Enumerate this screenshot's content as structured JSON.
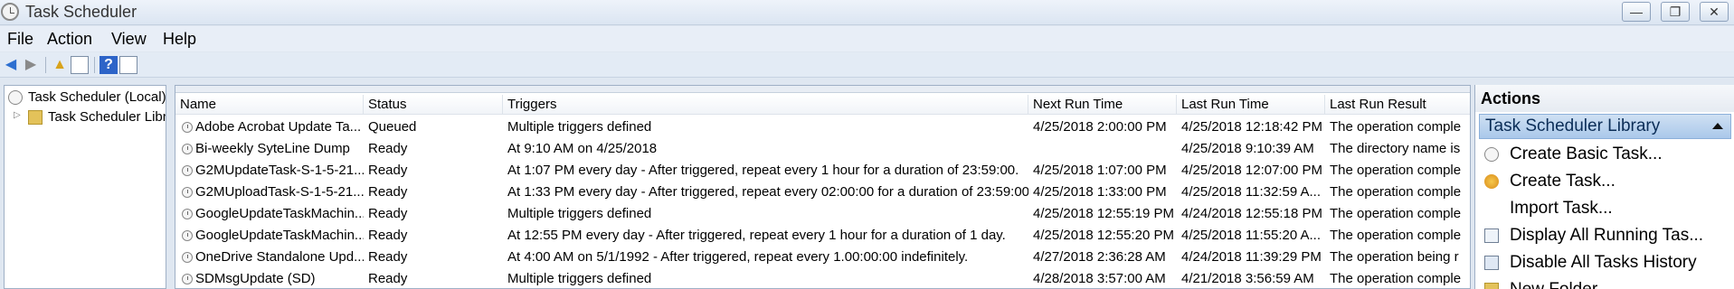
{
  "window": {
    "title": "Task Scheduler",
    "controls": {
      "minimize": "—",
      "restore": "❐",
      "close": "✕"
    }
  },
  "menu": [
    "File",
    "Action",
    "View",
    "Help"
  ],
  "tree": {
    "root": "Task Scheduler (Local)",
    "child": "Task Scheduler Library"
  },
  "list": {
    "headers": {
      "name": "Name",
      "status": "Status",
      "triggers": "Triggers",
      "next_run": "Next Run Time",
      "last_run": "Last Run Time",
      "last_result": "Last Run Result"
    },
    "rows": [
      {
        "name": "Adobe Acrobat Update Ta...",
        "status": "Queued",
        "triggers": "Multiple triggers defined",
        "next_run": "4/25/2018 2:00:00 PM",
        "last_run": "4/25/2018 12:18:42 PM",
        "last_result": "The operation comple"
      },
      {
        "name": "Bi-weekly SyteLine Dump",
        "status": "Ready",
        "triggers": "At 9:10 AM on 4/25/2018",
        "next_run": "",
        "last_run": "4/25/2018 9:10:39 AM",
        "last_result": "The directory name is"
      },
      {
        "name": "G2MUpdateTask-S-1-5-21...",
        "status": "Ready",
        "triggers": "At 1:07 PM every day - After triggered, repeat every 1 hour for a duration of 23:59:00.",
        "next_run": "4/25/2018 1:07:00 PM",
        "last_run": "4/25/2018 12:07:00 PM",
        "last_result": "The operation comple"
      },
      {
        "name": "G2MUploadTask-S-1-5-21...",
        "status": "Ready",
        "triggers": "At 1:33 PM every day - After triggered, repeat every 02:00:00 for a duration of 23:59:00.",
        "next_run": "4/25/2018 1:33:00 PM",
        "last_run": "4/25/2018 11:32:59 A...",
        "last_result": "The operation comple"
      },
      {
        "name": "GoogleUpdateTaskMachin...",
        "status": "Ready",
        "triggers": "Multiple triggers defined",
        "next_run": "4/25/2018 12:55:19 PM",
        "last_run": "4/24/2018 12:55:18 PM",
        "last_result": "The operation comple"
      },
      {
        "name": "GoogleUpdateTaskMachin...",
        "status": "Ready",
        "triggers": "At 12:55 PM every day - After triggered, repeat every 1 hour for a duration of 1 day.",
        "next_run": "4/25/2018 12:55:20 PM",
        "last_run": "4/25/2018 11:55:20 A...",
        "last_result": "The operation comple"
      },
      {
        "name": "OneDrive Standalone Upd...",
        "status": "Ready",
        "triggers": "At 4:00 AM on 5/1/1992 - After triggered, repeat every 1.00:00:00 indefinitely.",
        "next_run": "4/27/2018 2:36:28 AM",
        "last_run": "4/24/2018 11:39:29 PM",
        "last_result": "The operation being r"
      },
      {
        "name": "SDMsgUpdate (SD)",
        "status": "Ready",
        "triggers": "Multiple triggers defined",
        "next_run": "4/28/2018 3:57:00 AM",
        "last_run": "4/21/2018 3:56:59 AM",
        "last_result": "The operation comple"
      }
    ]
  },
  "actions": {
    "title": "Actions",
    "section": "Task Scheduler Library",
    "items": [
      {
        "label": "Create Basic Task...",
        "icon": "create-basic-task-icon"
      },
      {
        "label": "Create Task...",
        "icon": "create-task-icon"
      },
      {
        "label": "Import Task...",
        "icon": ""
      },
      {
        "label": "Display All Running Tas...",
        "icon": "running-tasks-icon"
      },
      {
        "label": "Disable All Tasks History",
        "icon": "disable-history-icon"
      },
      {
        "label": "New Folder...",
        "icon": "new-folder-icon"
      }
    ]
  },
  "colors": {
    "accent": "#aac8ea",
    "title_bar": "#dbe5f2",
    "selection_header": "#cfe0f3"
  }
}
